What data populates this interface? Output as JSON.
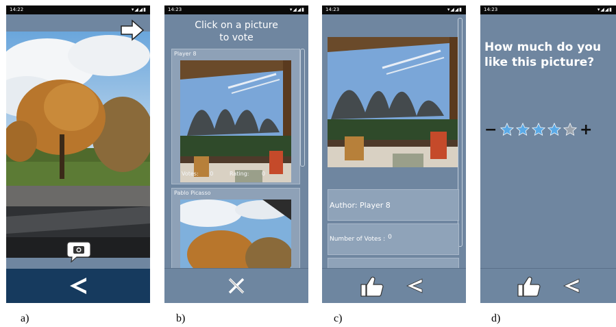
{
  "screens": [
    {
      "id": "a",
      "caption": "a)",
      "status_time": "14:22",
      "status_icons": "▾◢◢▮",
      "icons": {
        "next": "arrow-right-icon",
        "camera": "camera-icon",
        "back": "chevron-left-icon"
      }
    },
    {
      "id": "b",
      "caption": "b)",
      "status_time": "14:23",
      "status_icons": "▾◢◢▮",
      "title_line1": "Click on a picture",
      "title_line2": "to vote",
      "cards": [
        {
          "author": "Player 8",
          "votes_label": "Votes:",
          "votes_value": "0",
          "rating_label": "Rating:",
          "rating_value": "0"
        },
        {
          "author": "Pablo Picasso"
        }
      ],
      "icons": {
        "close": "close-icon"
      }
    },
    {
      "id": "c",
      "caption": "c)",
      "status_time": "14:23",
      "status_icons": "▾◢◢▮",
      "author_line": "Author: Player 8",
      "votes_line_label": "Number of Votes :",
      "votes_line_value": "0",
      "icons": {
        "vote": "thumbs-up-icon",
        "back": "chevron-left-icon"
      }
    },
    {
      "id": "d",
      "caption": "d)",
      "status_time": "14:23",
      "status_icons": "▾◢◢▮",
      "question_line1": "How much do you",
      "question_line2": "like this picture?",
      "rating": {
        "value": 4,
        "max": 5,
        "minus": "−",
        "plus": "+"
      },
      "icons": {
        "vote": "thumbs-up-icon",
        "back": "chevron-left-icon"
      }
    }
  ],
  "colors": {
    "panel": "#6f86a0",
    "nav_dark": "#163a5e",
    "nav": "#6e86a0",
    "star": "#5aa9e6",
    "star_empty": "#9aa3ad"
  }
}
